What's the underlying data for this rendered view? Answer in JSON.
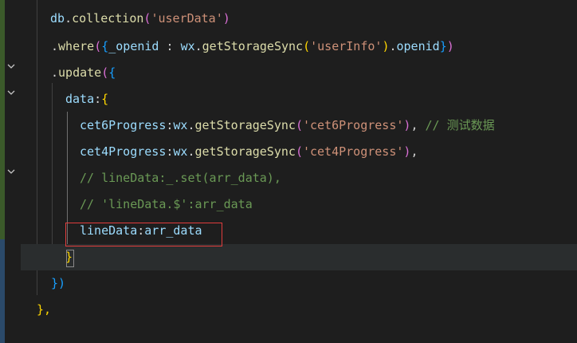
{
  "code": {
    "line1": {
      "obj": "db",
      "dot": ".",
      "fn": "collection",
      "open": "(",
      "str": "'userData'",
      "close": ")"
    },
    "line2": {
      "dot": ".",
      "fn": "where",
      "open_paren": "(",
      "open_brace": "{",
      "key": "_openid",
      "colon": " : ",
      "obj": "wx",
      "dot2": ".",
      "fn2": "getStorageSync",
      "open_paren2": "(",
      "str": "'userInfo'",
      "close_paren2": ")",
      "dot3": ".",
      "prop": "openid",
      "close_brace": "}",
      "close_paren": ")"
    },
    "line3": {
      "dot": ".",
      "fn": "update",
      "open_paren": "(",
      "open_brace": "{"
    },
    "line4": {
      "key": "data",
      "colon": ":",
      "open_brace": "{"
    },
    "line5": {
      "key": "cet6Progress",
      "colon": ":",
      "obj": "wx",
      "dot": ".",
      "fn": "getStorageSync",
      "open": "(",
      "str": "'cet6Progress'",
      "close": ")",
      "comma": ", ",
      "comment": "// 测试数据"
    },
    "line6": {
      "key": "cet4Progress",
      "colon": ":",
      "obj": "wx",
      "dot": ".",
      "fn": "getStorageSync",
      "open": "(",
      "str": "'cet4Progress'",
      "close": ")",
      "comma": ","
    },
    "line7": {
      "comment": "// lineData:_.set(arr_data),"
    },
    "line8": {
      "comment": "// 'lineData.$':arr_data"
    },
    "line9": {
      "key": "lineData",
      "colon": ":",
      "value": "arr_data"
    },
    "line10": {
      "close_brace": "}"
    },
    "line11": {
      "close_paren": "})"
    },
    "line12": {
      "close": "},"
    }
  },
  "colors": {
    "background": "#1e1e1e",
    "highlight_box": "#e03c3c",
    "current_line": "#2a2d2e"
  }
}
